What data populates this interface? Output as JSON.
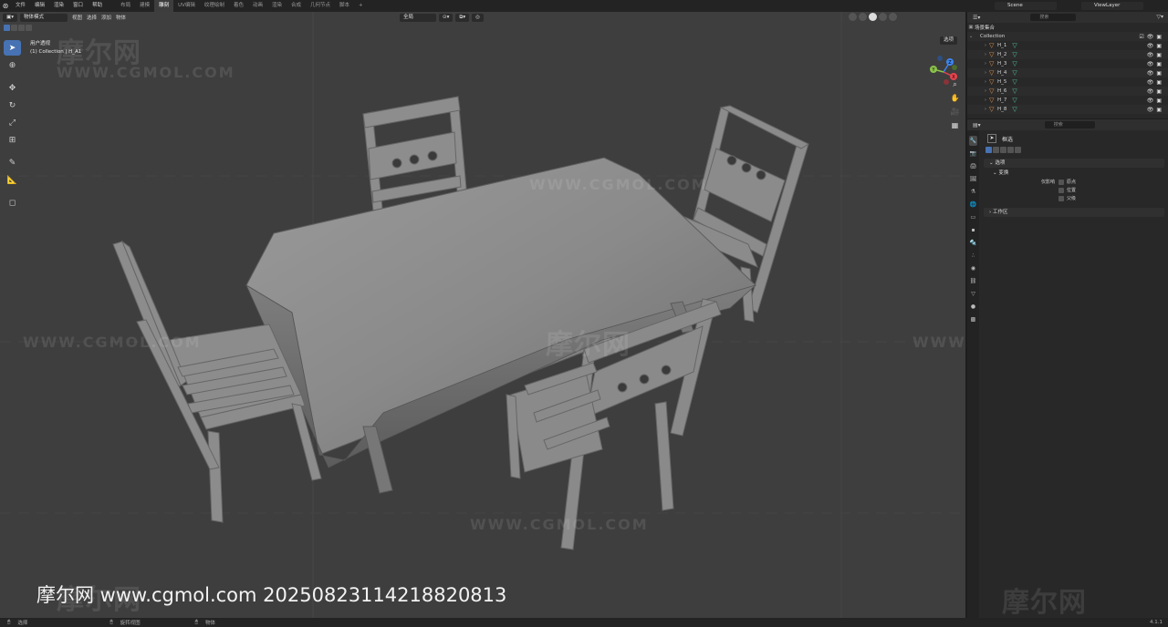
{
  "top_menu": {
    "items": [
      "文件",
      "编辑",
      "渲染",
      "窗口",
      "帮助"
    ],
    "workspace_tabs": [
      "布局",
      "建模",
      "雕刻",
      "UV编辑",
      "纹理绘制",
      "着色",
      "动画",
      "渲染",
      "合成",
      "几何节点",
      "脚本"
    ],
    "active_tab_index": 2,
    "add_tab": "+",
    "scene": "Scene",
    "view_layer": "ViewLayer"
  },
  "viewport": {
    "mode": "物体模式",
    "header_menus": [
      "视图",
      "选择",
      "添加",
      "物体"
    ],
    "transform_orientation": "全局",
    "view_name": "用户透视",
    "collection_line": "(1) Collection | H_A1",
    "options_label": "选项",
    "gizmo_axes": [
      "X",
      "Y",
      "Z"
    ]
  },
  "watermarks": {
    "brand": "摩尔网",
    "url": "WWW.CGMOL.COM",
    "caption": "摩尔网 www.cgmol.com 20250823114218820813"
  },
  "outliner": {
    "search_placeholder": "搜索",
    "root": "场景集合",
    "collection": "Collection",
    "objects": [
      "H_1",
      "H_2",
      "H_3",
      "H_4",
      "H_5",
      "H_6",
      "H_7",
      "H_8"
    ]
  },
  "properties": {
    "search_placeholder": "搜索",
    "tool_name": "框选",
    "panel_options": "选项",
    "panel_transform": "变换",
    "affect_only_label": "仅影响",
    "affect_items": [
      "原点",
      "位置",
      "父级"
    ],
    "panel_workspace": "工作区"
  },
  "status_bar": {
    "left": "选择",
    "middle": "旋转视图",
    "right": "物体",
    "version": "4.1.1"
  },
  "colors": {
    "accent": "#4772b3",
    "viewport_bg": "#3e3e3e",
    "x_axis": "#e8434e",
    "y_axis": "#8bc34a",
    "z_axis": "#3d85f0"
  }
}
